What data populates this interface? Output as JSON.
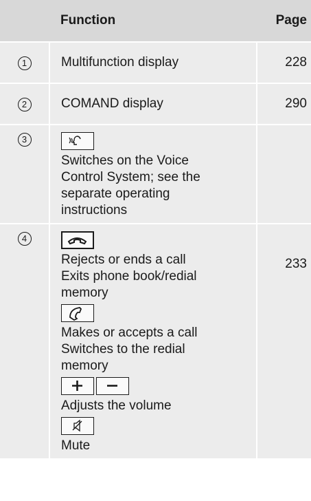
{
  "header": {
    "function": "Function",
    "page": "Page"
  },
  "rows": [
    {
      "num": "1",
      "function": "Multifunction display",
      "page": "228"
    },
    {
      "num": "2",
      "function": "COMAND display",
      "page": "290"
    },
    {
      "num": "3",
      "voice_lines": [
        "Switches on the Voice",
        "Control System; see the",
        "separate operating",
        "instructions"
      ]
    },
    {
      "num": "4",
      "page": "233",
      "end_call_lines": [
        "Rejects or ends a call",
        "Exits phone book/redial",
        "memory"
      ],
      "accept_call_lines": [
        "Makes or accepts a call",
        "Switches to the redial",
        "memory"
      ],
      "volume_line": "Adjusts the volume",
      "mute_line": "Mute"
    }
  ],
  "icons": [
    "voice-control-key-icon",
    "end-call-key-icon",
    "accept-call-key-icon",
    "volume-plus-key-icon",
    "volume-minus-key-icon",
    "mute-key-icon"
  ]
}
